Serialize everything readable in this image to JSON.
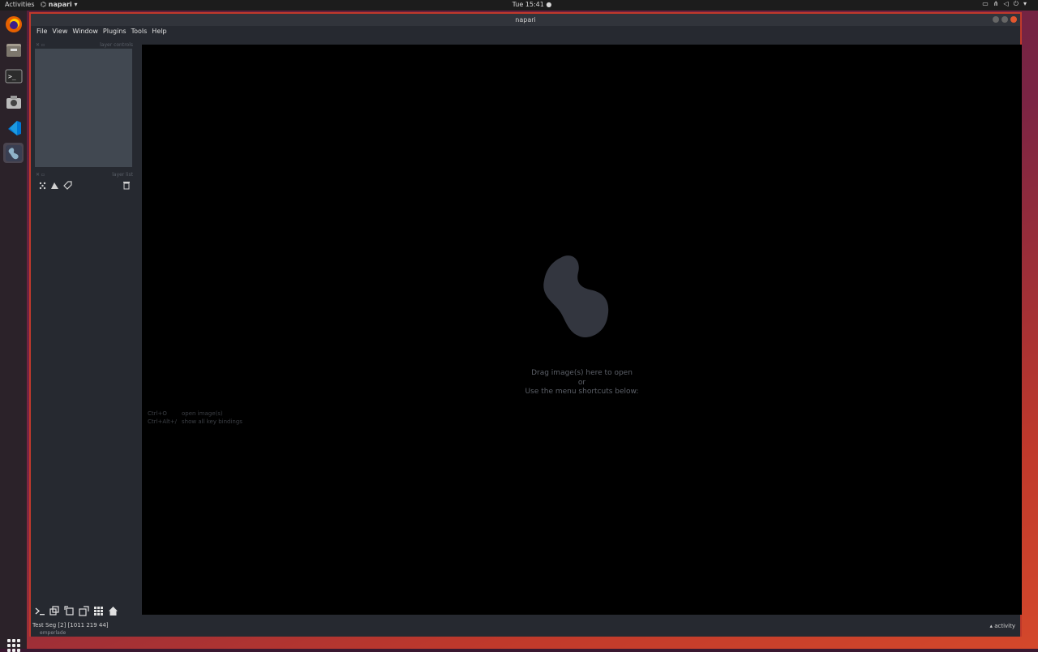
{
  "topbar": {
    "activities": "Activities",
    "app_name": "napari",
    "clock": "Tue 15:41"
  },
  "window": {
    "title": "napari"
  },
  "menu": {
    "items": [
      "File",
      "View",
      "Window",
      "Plugins",
      "Tools",
      "Help"
    ]
  },
  "left_panel": {
    "layer_controls_title": "layer controls",
    "layer_list_title": "layer list"
  },
  "canvas": {
    "drag_text": "Drag image(s) here to open",
    "or_text": "or",
    "menu_text": "Use the menu shortcuts below:",
    "shortcuts": [
      {
        "key": "Ctrl+O",
        "desc": "open image(s)"
      },
      {
        "key": "Ctrl+Alt+/",
        "desc": "show all key bindings"
      }
    ]
  },
  "statusbar": {
    "main": "Test Seg [2] [1011  219  44]",
    "sub": "emperlade",
    "activity": "activity"
  },
  "colors": {
    "accent": "#c0392b",
    "panel": "#262930",
    "layer_controls": "#414851",
    "canvas": "#000000"
  },
  "dock_icons": [
    "firefox-icon",
    "files-icon",
    "terminal-icon",
    "camera-icon",
    "vscode-icon",
    "napari-icon"
  ]
}
